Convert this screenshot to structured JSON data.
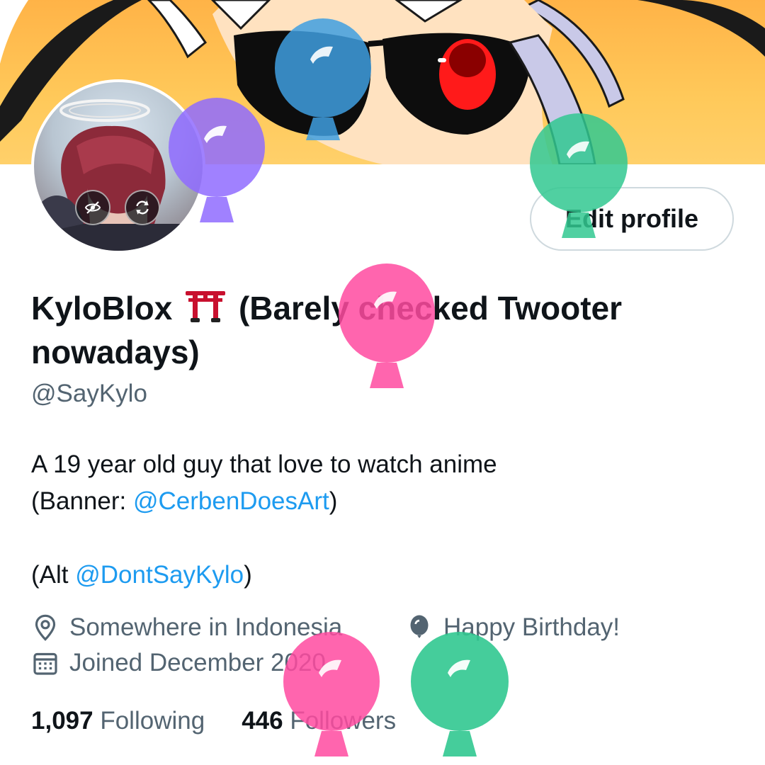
{
  "profile": {
    "display_name_part1": "KyloBlox",
    "display_name_part2": "(Barely checked Twooter nowadays)",
    "name_emoji": "torii-gate",
    "handle": "@SayKylo",
    "edit_button": "Edit profile"
  },
  "bio": {
    "line1": "A 19 year old guy that love to watch anime",
    "line2_prefix": "(Banner: ",
    "line2_mention": "@CerbenDoesArt",
    "line2_suffix": ")",
    "line3_prefix": "(Alt ",
    "line3_mention": "@DontSayKylo",
    "line3_suffix": ")"
  },
  "meta": {
    "location": "Somewhere in Indonesia",
    "birthday": "Happy Birthday!",
    "joined": "Joined December 2020"
  },
  "stats": {
    "following_count": "1,097",
    "following_label": "Following",
    "followers_count": "446",
    "followers_label": "Followers"
  },
  "icons": {
    "location": "location-pin-icon",
    "birthday": "balloon-icon",
    "joined": "calendar-icon",
    "avatar_hide": "eye-slash-icon",
    "avatar_swap": "refresh-icon"
  },
  "colors": {
    "accent": "#1d9bf0",
    "text_primary": "#0f1419",
    "text_secondary": "#536471",
    "balloon_purple": "#9b7bff",
    "balloon_blue": "#4da6e0",
    "balloon_green": "#3fcf9a",
    "balloon_pink": "#ff5ba8"
  }
}
